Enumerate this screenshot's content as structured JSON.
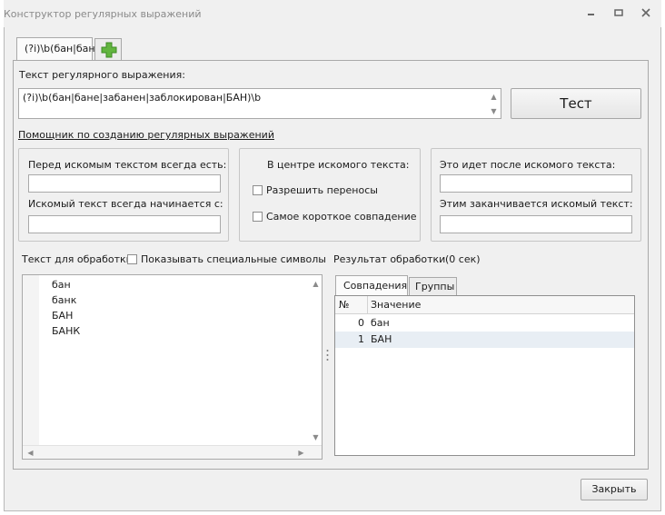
{
  "window": {
    "title": "Конструктор регулярных выражений",
    "controls": {
      "minimize_icon": "minimize-icon",
      "maximize_icon": "maximize-icon",
      "close_icon": "close-icon"
    }
  },
  "tabs": [
    {
      "label": "(?i)\\b(бан|бан"
    }
  ],
  "add_tab_icon": "plus-icon",
  "regex": {
    "label": "Текст регулярного выражения:",
    "value": "(?i)\\b(бан|бане|забанен|заблокирован|БАН)\\b",
    "test_button": "Тест"
  },
  "helper_link": "Помощник по созданию регулярных выражений",
  "helper": {
    "before_label": "Перед искомым текстом всегда есть:",
    "starts_label": "Искомый текст всегда начинается с:",
    "center_label": "В центре искомого текста:",
    "allow_wraps": "Разрешить переносы",
    "shortest_match": "Самое короткое совпадение",
    "after_label": "Это идет после искомого текста:",
    "ends_label": "Этим заканчивается искомый текст:"
  },
  "input_text": {
    "label": "Текст для обработки",
    "show_special": "Показывать специальные символы",
    "lines": [
      "бан",
      "банк",
      "БАН",
      "БАНК"
    ]
  },
  "result": {
    "label": "Результат обработки",
    "time": "(0 сек)",
    "tabs": [
      "Совпадения",
      "Группы"
    ],
    "columns": [
      "№",
      "Значение"
    ],
    "rows": [
      {
        "num": "0",
        "value": "бан"
      },
      {
        "num": "1",
        "value": "БАН"
      }
    ]
  },
  "close_button": "Закрыть"
}
